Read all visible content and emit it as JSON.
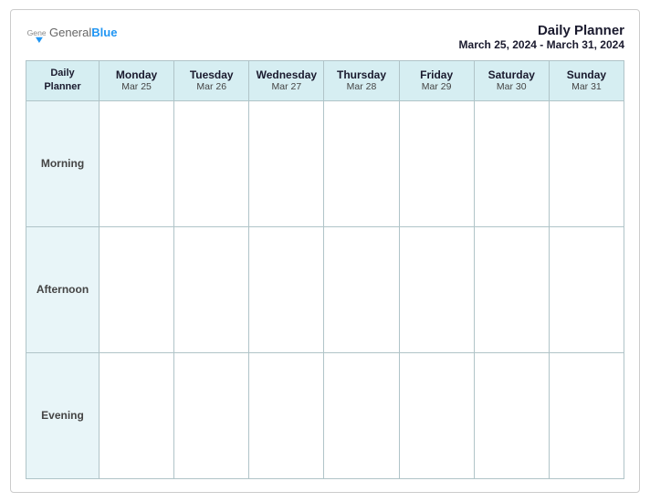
{
  "header": {
    "logo_general": "General",
    "logo_blue": "Blue",
    "title": "Daily Planner",
    "subtitle": "March 25, 2024 - March 31, 2024"
  },
  "table": {
    "header_label_line1": "Daily",
    "header_label_line2": "Planner",
    "columns": [
      {
        "day": "Monday",
        "date": "Mar 25"
      },
      {
        "day": "Tuesday",
        "date": "Mar 26"
      },
      {
        "day": "Wednesday",
        "date": "Mar 27"
      },
      {
        "day": "Thursday",
        "date": "Mar 28"
      },
      {
        "day": "Friday",
        "date": "Mar 29"
      },
      {
        "day": "Saturday",
        "date": "Mar 30"
      },
      {
        "day": "Sunday",
        "date": "Mar 31"
      }
    ],
    "rows": [
      {
        "label": "Morning"
      },
      {
        "label": "Afternoon"
      },
      {
        "label": "Evening"
      }
    ]
  }
}
